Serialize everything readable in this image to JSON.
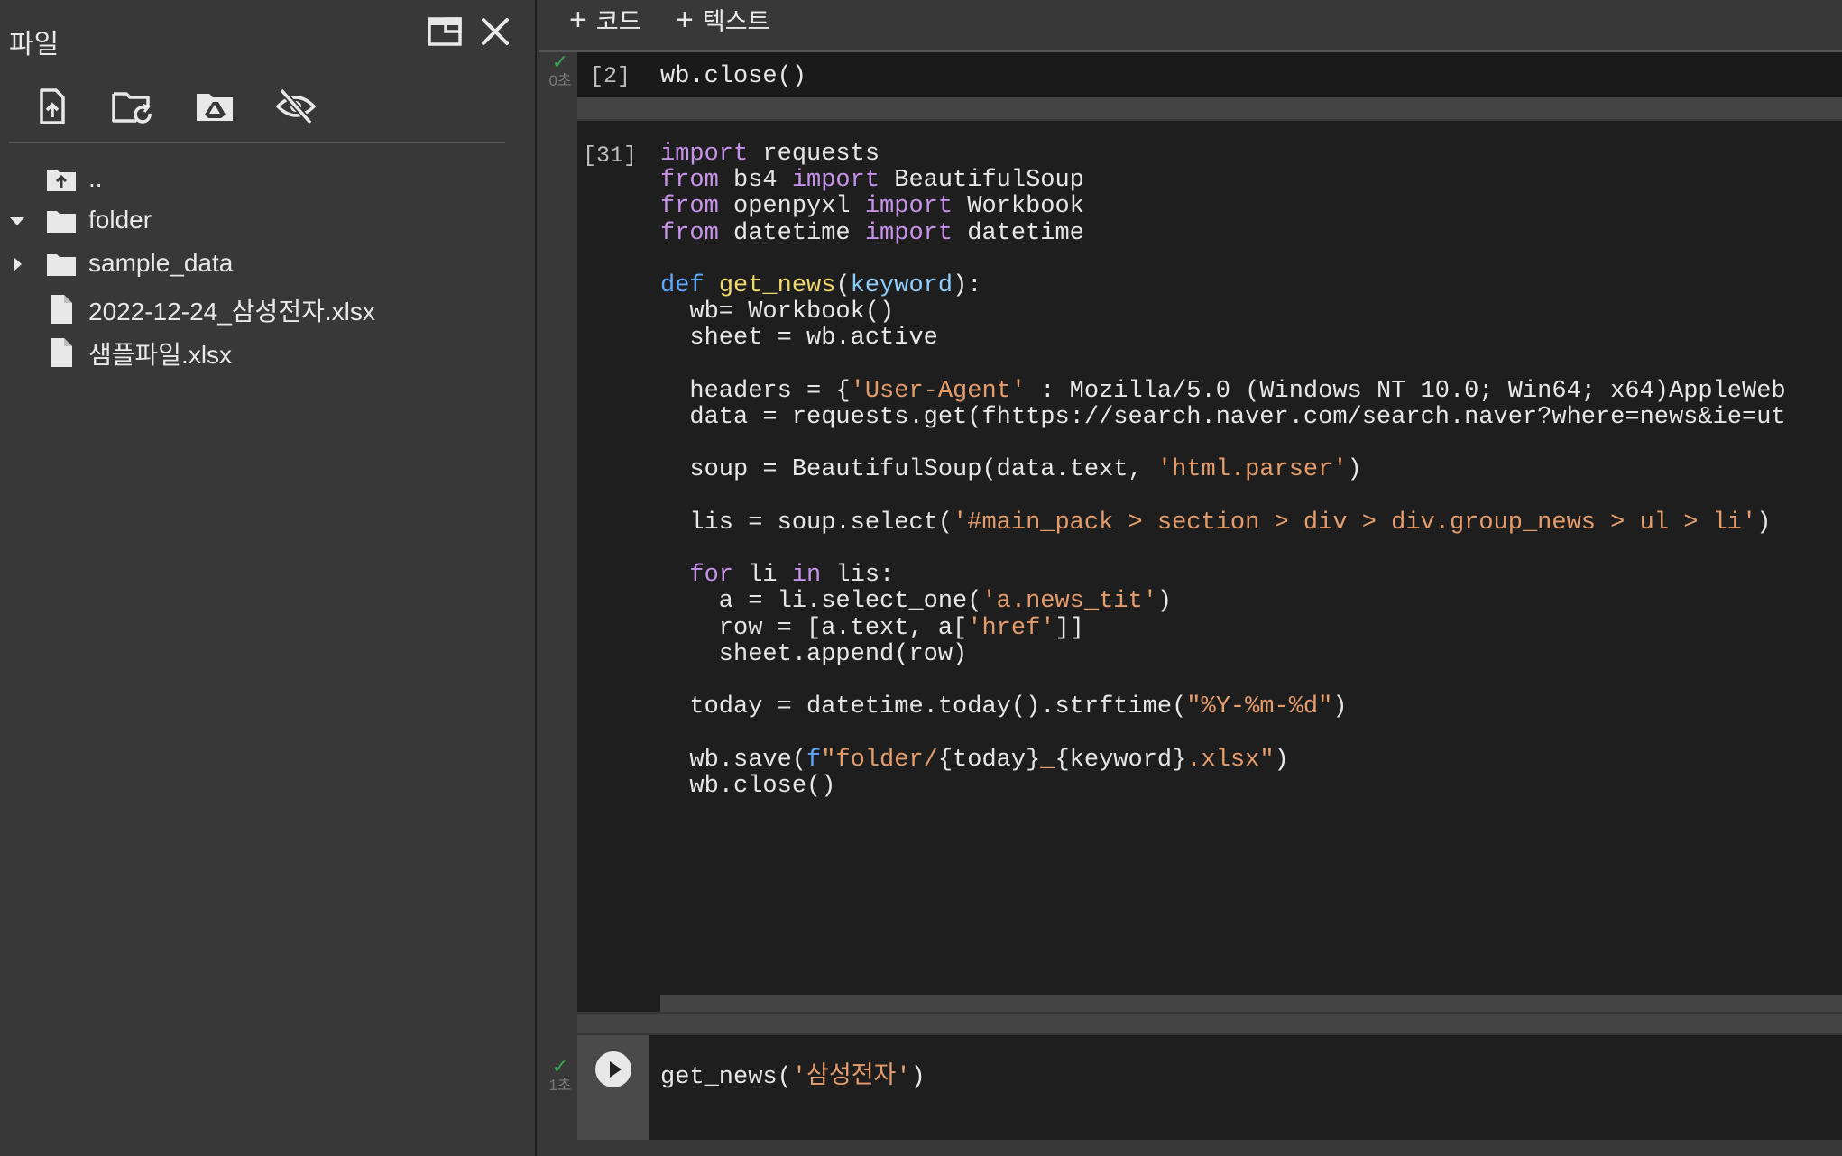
{
  "file_panel": {
    "title": "파일",
    "tree": [
      {
        "label": "..",
        "icon": "folder-up-icon",
        "caret": ""
      },
      {
        "label": "folder",
        "icon": "folder-icon",
        "caret": "expanded"
      },
      {
        "label": "sample_data",
        "icon": "folder-icon",
        "caret": "collapsed"
      },
      {
        "label": "2022-12-24_삼성전자.xlsx",
        "icon": "file-icon",
        "caret": ""
      },
      {
        "label": "샘플파일.xlsx",
        "icon": "file-icon",
        "caret": ""
      }
    ]
  },
  "toolbar": {
    "add_code": "코드",
    "add_text": "텍스트"
  },
  "cells": [
    {
      "exec_count": "[2]",
      "status_time": "0초",
      "code": [
        "wb.close()"
      ]
    },
    {
      "exec_count": "[31]",
      "status_time": "",
      "code": [
        "import requests",
        "from bs4 import BeautifulSoup",
        "from openpyxl import Workbook",
        "from datetime import datetime",
        "",
        "def get_news(keyword):",
        "  wb= Workbook()",
        "  sheet = wb.active",
        "",
        "  headers = {'User-Agent' : 'Mozilla/5.0 (Windows NT 10.0; Win64; x64)AppleWeb",
        "  data = requests.get(f'https://search.naver.com/search.naver?where=news&ie=ut",
        "",
        "  soup = BeautifulSoup(data.text, 'html.parser')",
        "",
        "  lis = soup.select('#main_pack > section > div > div.group_news > ul > li')",
        "",
        "  for li in lis:",
        "    a = li.select_one('a.news_tit')",
        "    row = [a.text, a['href']]",
        "    sheet.append(row)",
        "",
        "  today = datetime.today().strftime(\"%Y-%m-%d\")",
        "",
        "  wb.save(f\"folder/{today}_{keyword}.xlsx\")",
        "  wb.close()"
      ]
    },
    {
      "exec_count": "",
      "status_time": "1초",
      "code": [
        "get_news('삼성전자')"
      ]
    }
  ],
  "colors": {
    "keyword": "#c792ea",
    "builtin_keyword": "#5fa8ff",
    "function": "#f1d86b",
    "parameter": "#8ecdfb",
    "string": "#e59c6b",
    "success": "#34a853"
  }
}
